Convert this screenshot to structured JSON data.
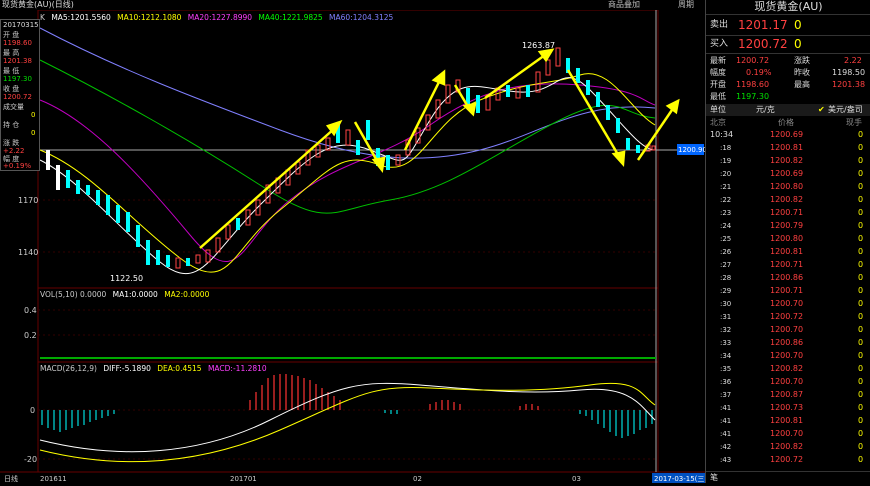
{
  "titlebar": {
    "title": "现货黄金(AU)(日线)",
    "add_label": "商品叠加",
    "week_label": "周期"
  },
  "ma_line": {
    "k": "K",
    "ma5": "MA5:1201.5560",
    "ma10": "MA10:1212.1080",
    "ma20": "MA20:1227.8990",
    "ma40": "MA40:1221.9825",
    "ma60": "MA60:1204.3125"
  },
  "vol_line": {
    "vol": "VOL(5,10) 0.0000",
    "ma1": "MA1:0.0000",
    "ma2": "MA2:0.0000"
  },
  "macd_line": {
    "macd": "MACD(26,12,9)",
    "diff": "DIFF:-5.1890",
    "dea": "DEA:0.4515",
    "macdv": "MACD:-11.2810"
  },
  "price_axis": [
    "1170",
    "1140"
  ],
  "vol_axis": [
    "0.4",
    "0.2"
  ],
  "macd_axis": [
    "0",
    "-20"
  ],
  "date_axis": [
    "日线",
    "201611",
    "201701",
    "02",
    "03"
  ],
  "annotations": {
    "high": "1263.87",
    "low": "1122.50",
    "current_price": "1200.90",
    "cursor_date": "2017-03-15(三)"
  },
  "infobox": {
    "date": "20170315",
    "open_l": "开 盘",
    "open_v": "1198.60",
    "high_l": "最 高",
    "high_v": "1201.38",
    "low_l": "最 低",
    "low_v": "1197.30",
    "close_l": "收 盘",
    "close_v": "1200.72",
    "vol_l": "成交量",
    "vol_v": "0",
    "pos_l": "持 仓",
    "pos_v": "0",
    "chg_l": "涨 跌",
    "chg_v": "+2.22",
    "pct_l": "幅 度",
    "pct_v": "+0.19%"
  },
  "panel": {
    "title": "现货黄金(AU)",
    "sell_label": "卖出",
    "sell_price": "1201.17",
    "sell_qty": "0",
    "buy_label": "买入",
    "buy_price": "1200.72",
    "buy_qty": "0",
    "stats": [
      {
        "l1": "最新",
        "v1": "1200.72",
        "l2": "涨跌",
        "v2": "2.22"
      },
      {
        "l1": "幅度",
        "v1": "0.19%",
        "l2": "昨收",
        "v2": "1198.50"
      },
      {
        "l1": "开盘",
        "v1": "1198.60",
        "l2": "最高",
        "v2": "1201.38"
      },
      {
        "l1": "最低",
        "v1": "1197.30",
        "l2": "",
        "v2": ""
      }
    ],
    "unit_label": "单位",
    "unit_value": "元/克",
    "unit_option": "美元/盎司",
    "tick_headers": [
      "北京",
      "价格",
      "现手"
    ],
    "ticks": [
      {
        "t": "10:34",
        "p": "1200.69",
        "q": "0"
      },
      {
        "t": ":18",
        "p": "1200.81",
        "q": "0"
      },
      {
        "t": ":19",
        "p": "1200.82",
        "q": "0"
      },
      {
        "t": ":20",
        "p": "1200.69",
        "q": "0"
      },
      {
        "t": ":21",
        "p": "1200.80",
        "q": "0"
      },
      {
        "t": ":22",
        "p": "1200.82",
        "q": "0"
      },
      {
        "t": ":23",
        "p": "1200.71",
        "q": "0"
      },
      {
        "t": ":24",
        "p": "1200.79",
        "q": "0"
      },
      {
        "t": ":25",
        "p": "1200.80",
        "q": "0"
      },
      {
        "t": ":26",
        "p": "1200.81",
        "q": "0"
      },
      {
        "t": ":27",
        "p": "1200.71",
        "q": "0"
      },
      {
        "t": ":28",
        "p": "1200.86",
        "q": "0"
      },
      {
        "t": ":29",
        "p": "1200.71",
        "q": "0"
      },
      {
        "t": ":30",
        "p": "1200.70",
        "q": "0"
      },
      {
        "t": ":31",
        "p": "1200.72",
        "q": "0"
      },
      {
        "t": ":32",
        "p": "1200.70",
        "q": "0"
      },
      {
        "t": ":33",
        "p": "1200.86",
        "q": "0"
      },
      {
        "t": ":34",
        "p": "1200.70",
        "q": "0"
      },
      {
        "t": ":35",
        "p": "1200.82",
        "q": "0"
      },
      {
        "t": ":36",
        "p": "1200.70",
        "q": "0"
      },
      {
        "t": ":37",
        "p": "1200.87",
        "q": "0"
      },
      {
        "t": ":41",
        "p": "1200.73",
        "q": "0"
      },
      {
        "t": ":41",
        "p": "1200.81",
        "q": "0"
      },
      {
        "t": ":41",
        "p": "1200.70",
        "q": "0"
      },
      {
        "t": ":42",
        "p": "1200.82",
        "q": "0"
      },
      {
        "t": ":43",
        "p": "1200.72",
        "q": "0"
      }
    ],
    "bottom_tab": "笔"
  }
}
